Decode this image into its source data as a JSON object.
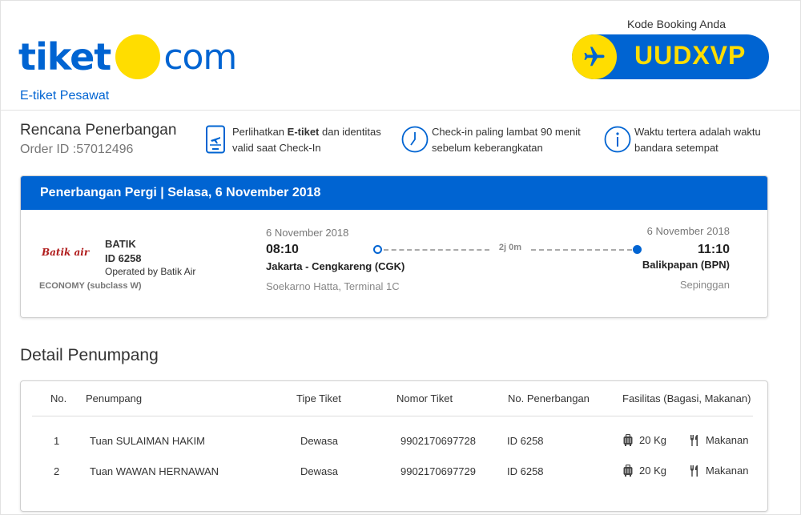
{
  "header": {
    "logo_left": "tiket",
    "logo_right": "com",
    "subtitle": "E-tiket Pesawat",
    "booking_caption": "Kode Booking Anda",
    "booking_code": "UUDXVP"
  },
  "plan": {
    "title": "Rencana Penerbangan",
    "order_id": "Order ID :57012496"
  },
  "info": [
    {
      "icon": "phone-ticket-icon",
      "pre": "Perlihatkan ",
      "bold": "E-tiket",
      "post": " dan identitas",
      "line2": "valid saat Check-In"
    },
    {
      "icon": "clock-icon",
      "line1": "Check-in paling lambat 90 menit",
      "line2": "sebelum keberangkatan"
    },
    {
      "icon": "info-icon",
      "line1": "Waktu tertera adalah waktu",
      "line2": "bandara setempat"
    }
  ],
  "flight": {
    "header": "Penerbangan Pergi | Selasa, 6 November 2018",
    "airline_logo": "Batik air",
    "airline": "BATIK",
    "flight_no": "ID 6258",
    "operated_by": "Operated by Batik Air",
    "cabin": "ECONOMY (subclass W)",
    "departure": {
      "date": "6 November 2018",
      "time": "08:10",
      "city": "Jakarta - Cengkareng (CGK)",
      "airport": "Soekarno Hatta, Terminal 1C"
    },
    "arrival": {
      "date": "6 November 2018",
      "time": "11:10",
      "city": "Balikpapan (BPN)",
      "airport": "Sepinggan"
    },
    "duration": "2j 0m"
  },
  "passengers": {
    "title": "Detail Penumpang",
    "columns": [
      "No.",
      "Penumpang",
      "Tipe Tiket",
      "Nomor Tiket",
      "No. Penerbangan",
      "Fasilitas (Bagasi, Makanan)"
    ],
    "rows": [
      {
        "no": "1",
        "name": "Tuan SULAIMAN HAKIM",
        "type": "Dewasa",
        "ticket": "9902170697728",
        "flight": "ID 6258",
        "baggage": "20 Kg",
        "meal": "Makanan"
      },
      {
        "no": "2",
        "name": "Tuan WAWAN HERNAWAN",
        "type": "Dewasa",
        "ticket": "9902170697729",
        "flight": "ID 6258",
        "baggage": "20 Kg",
        "meal": "Makanan"
      }
    ]
  },
  "colors": {
    "brand_blue": "#0064d2",
    "brand_yellow": "#ffdd00"
  }
}
